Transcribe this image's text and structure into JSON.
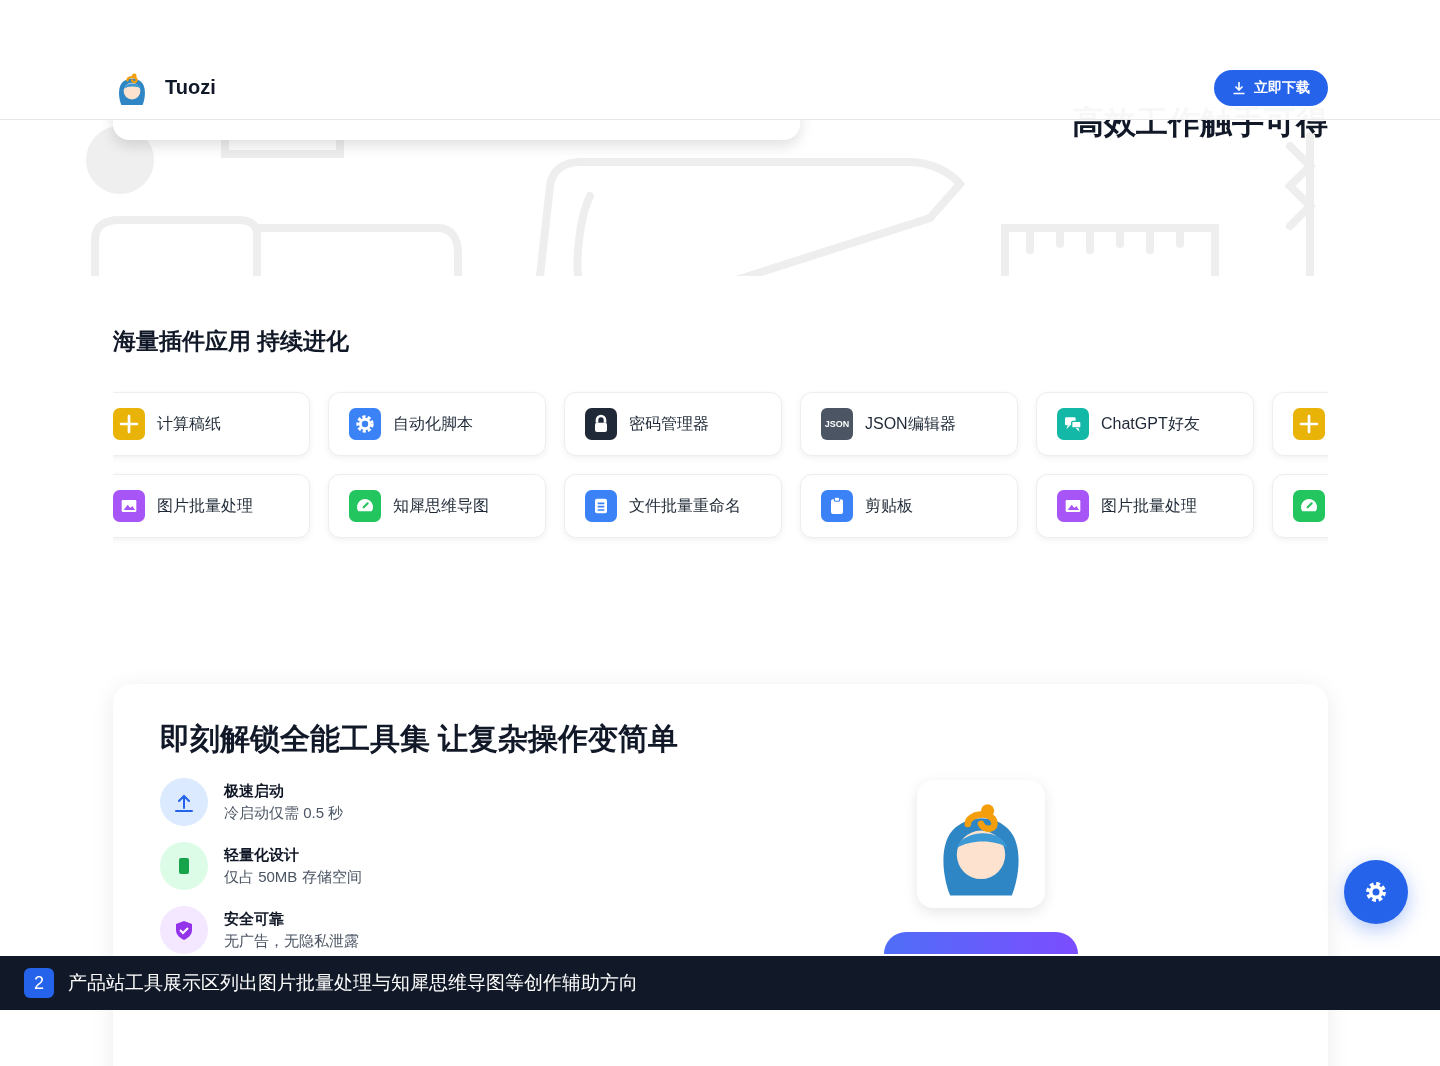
{
  "header": {
    "brand": "Tuozi",
    "download_button": "立即下载"
  },
  "hero": {
    "heading": "高效工作触手可得"
  },
  "plugins": {
    "title": "海量插件应用 持续进化",
    "rows": [
      [
        {
          "kind": "plus",
          "color": "#eab308",
          "label": "计算稿纸"
        },
        {
          "kind": "gear",
          "color": "#3b82f6",
          "label": "自动化脚本"
        },
        {
          "kind": "lock",
          "color": "#1f2937",
          "label": "密码管理器"
        },
        {
          "kind": "json",
          "color": "#4b5563",
          "icon_text": "JSON",
          "label": "JSON编辑器"
        },
        {
          "kind": "chat",
          "color": "#14b8a6",
          "label": "ChatGPT好友"
        },
        {
          "kind": "plus",
          "color": "#eab308"
        }
      ],
      [
        {
          "kind": "image",
          "color": "#a855f7",
          "label": "图片批量处理"
        },
        {
          "kind": "gauge",
          "color": "#22c55e",
          "label": "知犀思维导图"
        },
        {
          "kind": "list",
          "color": "#3b82f6",
          "label": "文件批量重命名"
        },
        {
          "kind": "clipboard",
          "color": "#3b82f6",
          "label": "剪贴板"
        },
        {
          "kind": "image",
          "color": "#a855f7",
          "label": "图片批量处理"
        },
        {
          "kind": "gauge",
          "color": "#22c55e"
        }
      ]
    ]
  },
  "cta": {
    "heading": "即刻解锁全能工具集 让复杂操作变简单",
    "features": [
      {
        "kind": "upload",
        "title": "极速启动",
        "description": "冷启动仅需 0.5 秒"
      },
      {
        "kind": "phone",
        "title": "轻量化设计",
        "description": "仅占 50MB 存储空间"
      },
      {
        "kind": "shield",
        "title": "安全可靠",
        "description": "无广告，无隐私泄露"
      }
    ]
  },
  "caption": {
    "number": "2",
    "text": "产品站工具展示区列出图片批量处理与知犀思维导图等创作辅助方向"
  }
}
